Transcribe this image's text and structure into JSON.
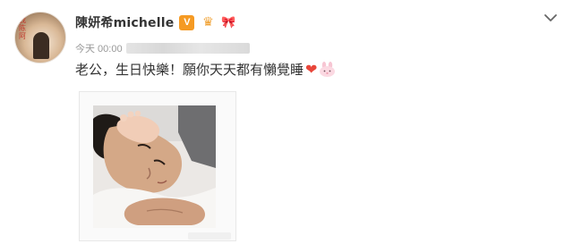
{
  "post": {
    "author": {
      "name": "陳妍希michelle",
      "avatar_sign_text": "我陈阿"
    },
    "badges": {
      "verified_icon": "verified-v-icon",
      "verified_label": "V",
      "vip_icon": "crown-icon",
      "gift_icon": "gift-icon",
      "verified_color": "#f59a23"
    },
    "timestamp": "今天 00:00",
    "text": "老公，生日快樂！願你天天都有懶覺睡",
    "emojis": [
      "heart-icon",
      "bunny-icon"
    ],
    "menu_icon": "chevron-down-icon",
    "image_alt_icon": "photo"
  },
  "colors": {
    "username": "#333333",
    "meta": "#999999",
    "body_text": "#333333",
    "heart": "#e8463a"
  }
}
